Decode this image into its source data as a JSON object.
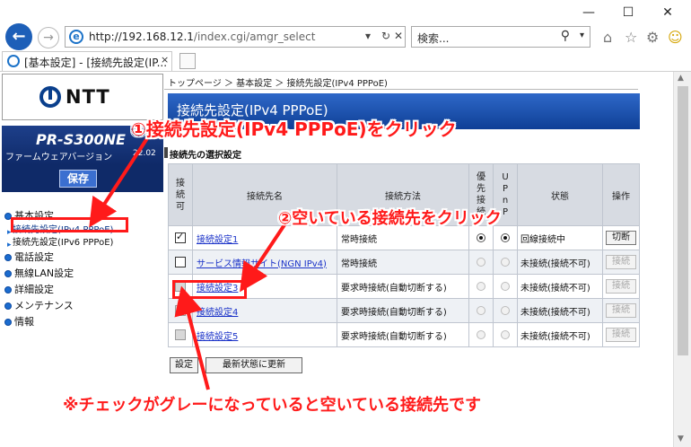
{
  "browser": {
    "win_minimize": "—",
    "win_maximize": "☐",
    "win_close": "✕",
    "url_host": "http://192.168.12.1",
    "url_path": "/index.cgi/amgr_select",
    "search_placeholder": "検索...",
    "tab_title": "[基本設定] - [接続先設定(IP...",
    "tab_close": "×"
  },
  "sidebar": {
    "brand": "NTT",
    "model": "PR-S300NE",
    "firmware_label": "ファームウェアバージョン",
    "firmware_version": "22.02",
    "save_label": "保存",
    "menu": {
      "basic": "基本設定",
      "sub1": "接続先設定(IPv4 PPPoE)",
      "sub2": "接続先設定(IPv6 PPPoE)",
      "phone": "電話設定",
      "wlan": "無線LAN設定",
      "detail": "詳細設定",
      "maint": "メンテナンス",
      "info": "情報"
    }
  },
  "content": {
    "breadcrumb": "トップページ ＞ 基本設定 ＞ 接続先設定(IPv4 PPPoE)",
    "title": "接続先設定(IPv4 PPPoE)",
    "section": "接続先の選択設定",
    "headers": {
      "enable": "接続可",
      "name": "接続先名",
      "method": "接続方法",
      "priority": "優先接続",
      "upnp": "UPnP",
      "status": "状態",
      "op": "操作"
    },
    "rows": [
      {
        "name": "接続設定1",
        "method": "常時接続",
        "status": "回線接続中",
        "op": "切断"
      },
      {
        "name": "サービス情報サイト(NGN IPv4)",
        "method": "常時接続",
        "status": "未接続(接続不可)",
        "op": "接続"
      },
      {
        "name": "接続設定3",
        "method": "要求時接続(自動切断する)",
        "status": "未接続(接続不可)",
        "op": "接続"
      },
      {
        "name": "接続設定4",
        "method": "要求時接続(自動切断する)",
        "status": "未接続(接続不可)",
        "op": "接続"
      },
      {
        "name": "接続設定5",
        "method": "要求時接続(自動切断する)",
        "status": "未接続(接続不可)",
        "op": "接続"
      }
    ],
    "set_label": "設定",
    "refresh_label": "最新状態に更新"
  },
  "annotations": {
    "step1": "①接続先設定(IPv4 PPPoE)をクリック",
    "step2": "②空いている接続先をクリック",
    "note": "※チェックがグレーになっていると空いている接続先です",
    "color": "#ff1a1a"
  }
}
